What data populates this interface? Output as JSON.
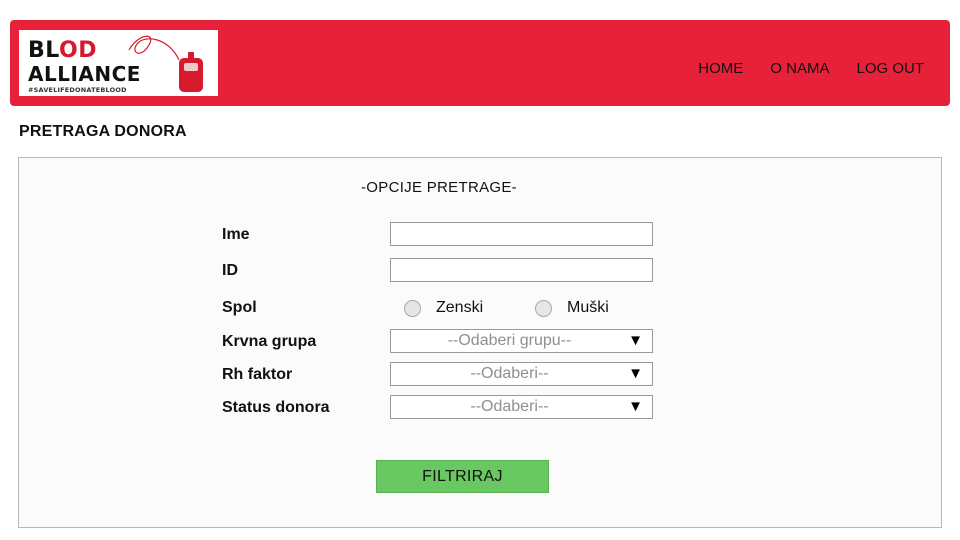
{
  "brand": {
    "logo_line1_a": "BL",
    "logo_line1_b": "OD",
    "logo_line2": "ALLIANCE",
    "logo_tagline": "#SAVELIFEDONATEBLOOD"
  },
  "nav": {
    "items": [
      {
        "label": "HOME"
      },
      {
        "label": "O NAMA"
      },
      {
        "label": "LOG OUT"
      }
    ]
  },
  "page": {
    "title": "PRETRAGA DONORA"
  },
  "search": {
    "panel_title": "-OPCIJE PRETRAGE-",
    "fields": {
      "ime": {
        "label": "Ime",
        "value": ""
      },
      "id": {
        "label": "ID",
        "value": ""
      },
      "spol": {
        "label": "Spol",
        "options": [
          "Zenski",
          "Muški"
        ]
      },
      "krvna_grupa": {
        "label": "Krvna grupa",
        "selected": "--Odaberi grupu--"
      },
      "rh_faktor": {
        "label": "Rh faktor",
        "selected": "--Odaberi--"
      },
      "status_donora": {
        "label": "Status donora",
        "selected": "--Odaberi--"
      }
    },
    "filter_button": "FILTRIRAJ"
  },
  "icons": {
    "dropdown_arrow": "▼"
  },
  "colors": {
    "header_bg": "#e8213a",
    "button_bg": "#69c862",
    "panel_bg": "#fcfbfb"
  }
}
